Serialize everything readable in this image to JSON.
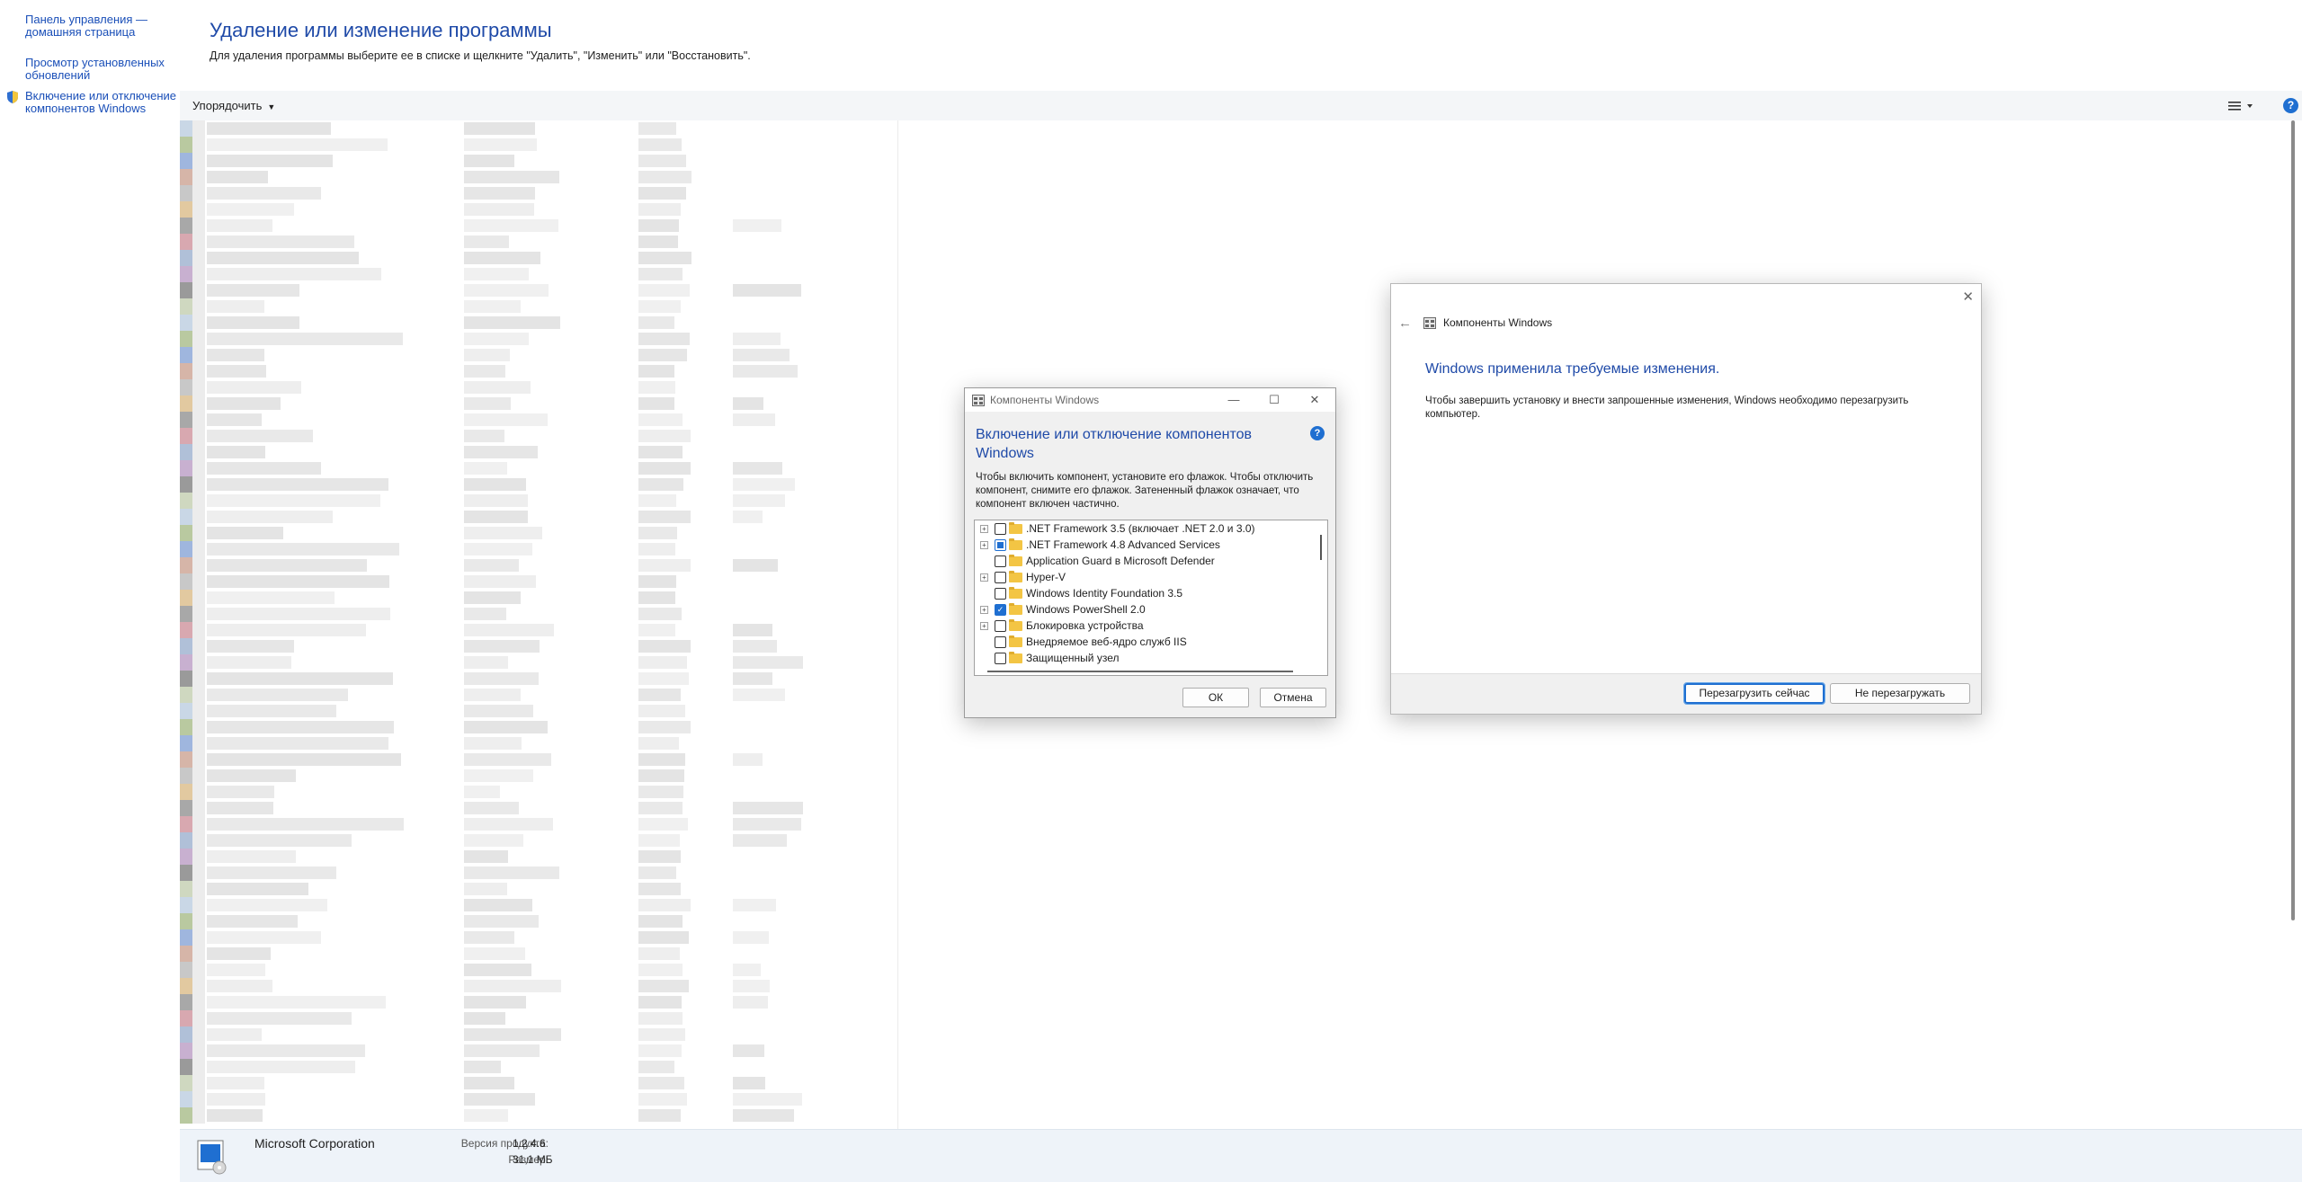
{
  "sidebar": {
    "links": [
      {
        "label": "Панель управления —\nдомашняя страница"
      },
      {
        "label": "Просмотр установленных\nобновлений"
      },
      {
        "label": "Включение или отключение\nкомпонентов Windows"
      }
    ]
  },
  "header": {
    "title": "Удаление или изменение программы",
    "description": "Для удаления программы выберите ее в списке и щелкните \"Удалить\", \"Изменить\" или \"Восстановить\"."
  },
  "toolbar": {
    "sort_label": "Упорядочить",
    "view_icon": "list-view-icon",
    "help_icon": "help-icon",
    "help_glyph": "?"
  },
  "details": {
    "publisher": "Microsoft Corporation",
    "version_label": "Версия продукта:",
    "version_value": "1.2.4.6",
    "size_label": "Размер:",
    "size_value": "31,1 МБ"
  },
  "features_dialog": {
    "window_title": "Компоненты Windows",
    "heading": "Включение или отключение компонентов Windows",
    "info_glyph": "?",
    "description": "Чтобы включить компонент, установите его флажок. Чтобы отключить компонент, снимите его флажок. Затененный флажок означает, что компонент включен частично.",
    "features": [
      {
        "label": ".NET Framework 3.5 (включает .NET 2.0 и 3.0)",
        "expandable": true,
        "state": "unchecked"
      },
      {
        "label": ".NET Framework 4.8 Advanced Services",
        "expandable": true,
        "state": "partial"
      },
      {
        "label": "Application Guard в Microsoft Defender",
        "expandable": false,
        "state": "unchecked"
      },
      {
        "label": "Hyper-V",
        "expandable": true,
        "state": "unchecked"
      },
      {
        "label": "Windows Identity Foundation 3.5",
        "expandable": false,
        "state": "unchecked"
      },
      {
        "label": "Windows PowerShell 2.0",
        "expandable": true,
        "state": "checked"
      },
      {
        "label": "Блокировка устройства",
        "expandable": true,
        "state": "unchecked"
      },
      {
        "label": "Внедряемое веб-ядро служб IIS",
        "expandable": false,
        "state": "unchecked"
      },
      {
        "label": "Защищенный узел",
        "expandable": false,
        "state": "unchecked"
      }
    ],
    "ok_label": "ОК",
    "cancel_label": "Отмена"
  },
  "restart_dialog": {
    "window_title": "Компоненты Windows",
    "message": "Windows применила требуемые изменения.",
    "sub_message": "Чтобы завершить установку и внести запрошенные изменения, Windows необходимо перезагрузить компьютер.",
    "restart_now_label": "Перезагрузить сейчас",
    "dont_restart_label": "Не перезагружать"
  },
  "colors": {
    "link": "#1a4fb8",
    "heading": "#1f4aa8",
    "accent": "#1f6fd1",
    "details_bg": "#eef3f9"
  }
}
